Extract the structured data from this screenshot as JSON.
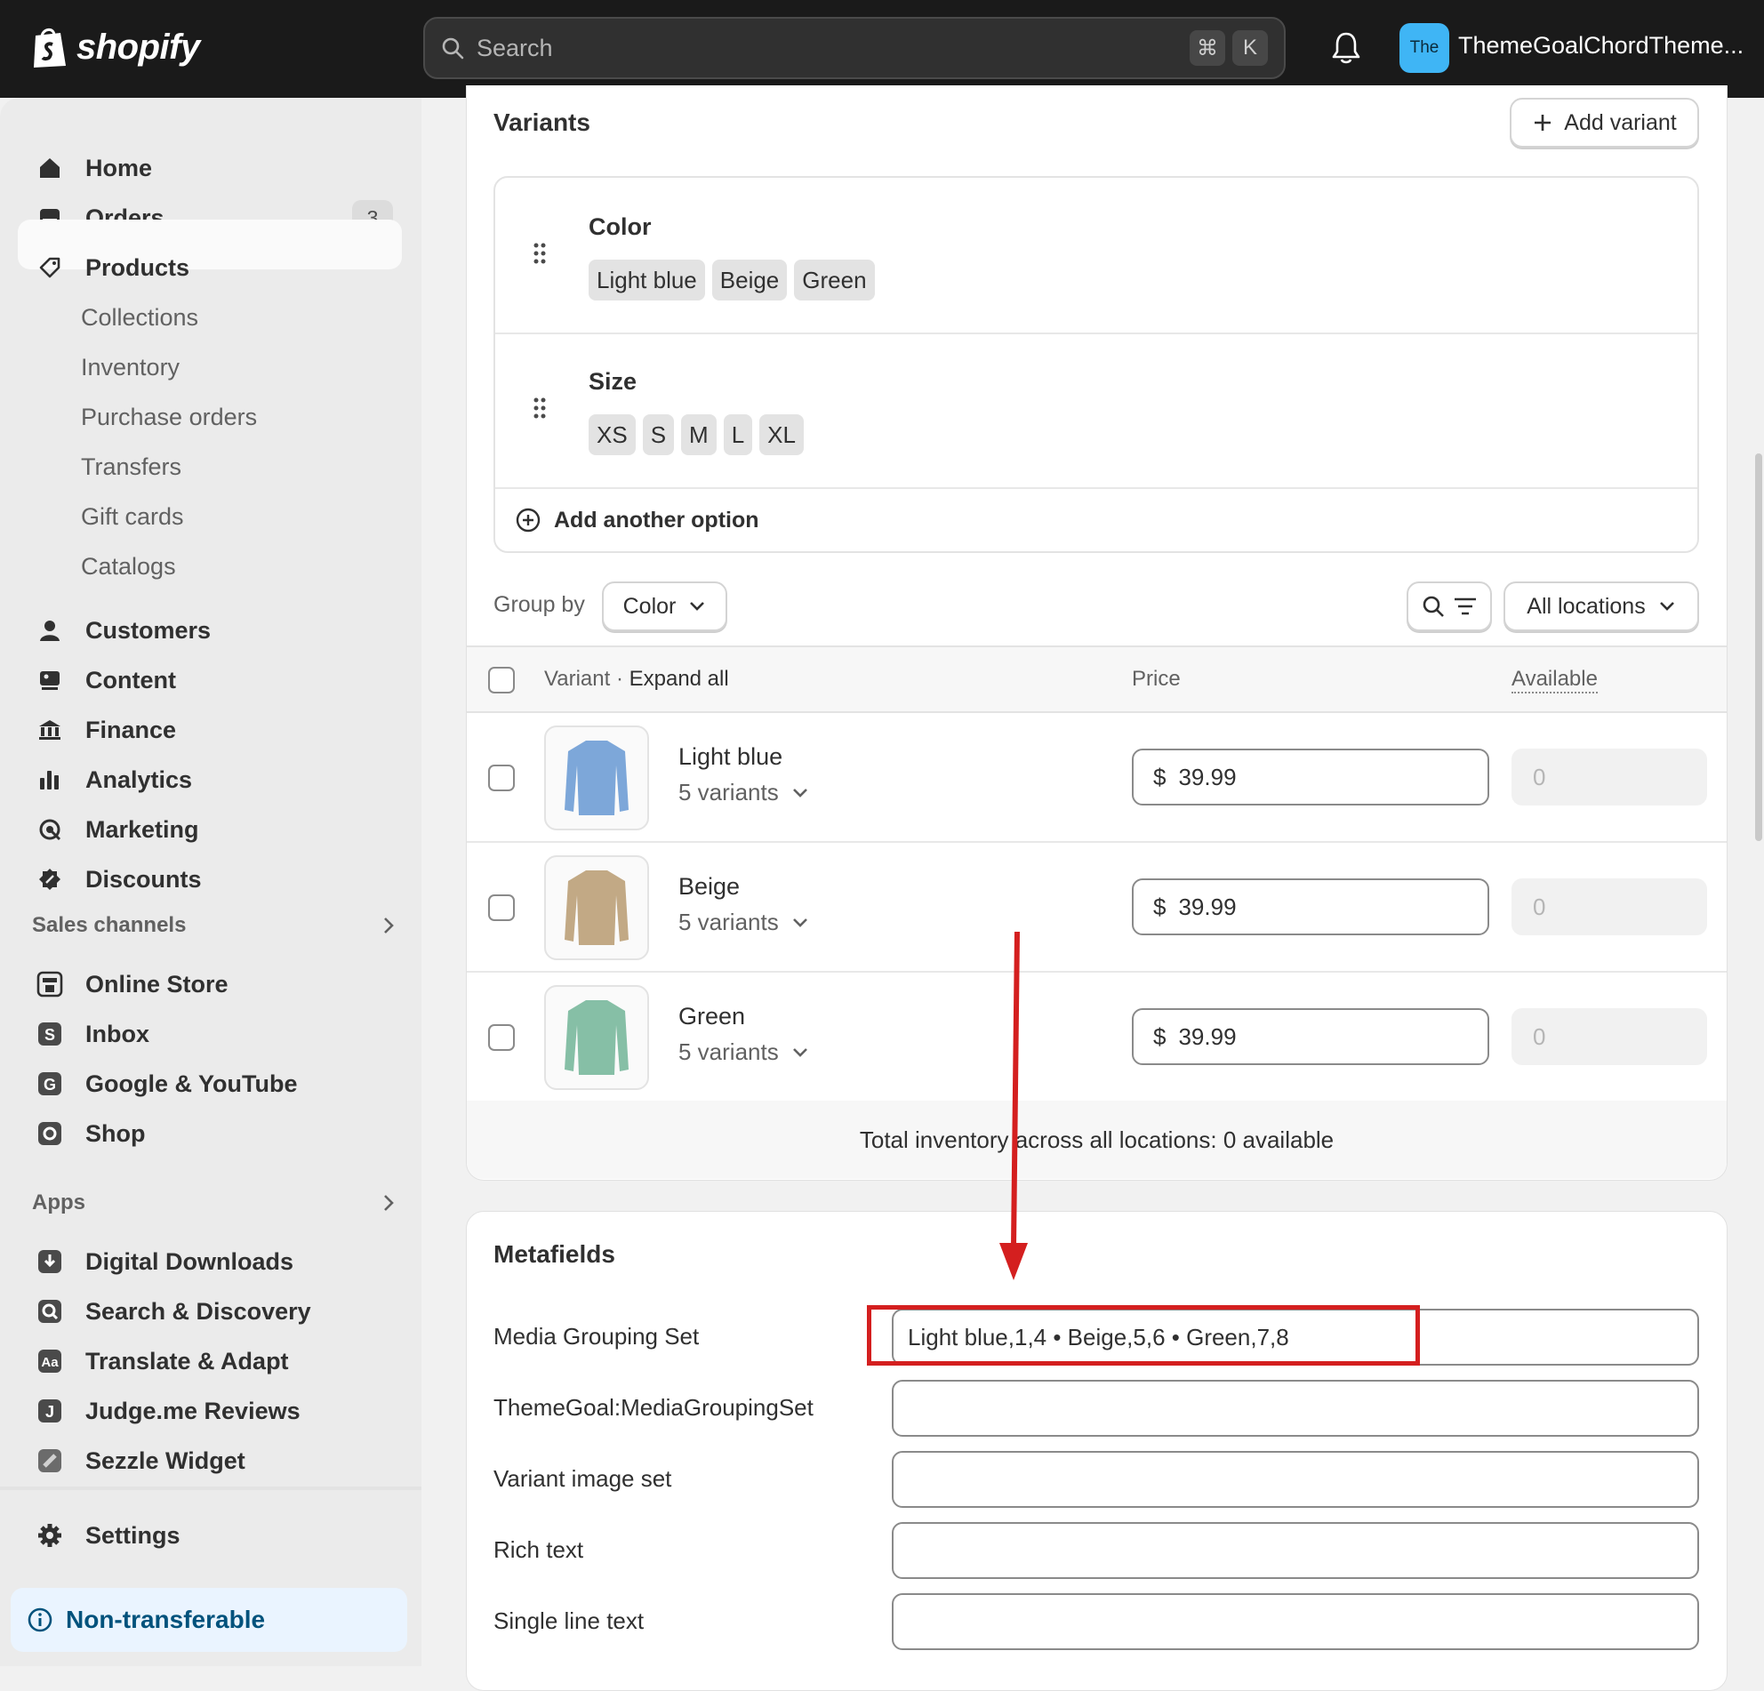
{
  "topbar": {
    "brand": "shopify",
    "search_placeholder": "Search",
    "shortcut_keys": [
      "⌘",
      "K"
    ],
    "avatar_initials": "The",
    "store_name": "ThemeGoalChordTheme..."
  },
  "sidebar": {
    "items": [
      {
        "label": "Home",
        "icon": "home-icon"
      },
      {
        "label": "Orders",
        "icon": "orders-icon",
        "badge": "3"
      },
      {
        "label": "Products",
        "icon": "tag-icon",
        "active": true
      },
      {
        "label": "Collections"
      },
      {
        "label": "Inventory"
      },
      {
        "label": "Purchase orders"
      },
      {
        "label": "Transfers"
      },
      {
        "label": "Gift cards"
      },
      {
        "label": "Catalogs"
      },
      {
        "label": "Customers",
        "icon": "person-icon"
      },
      {
        "label": "Content",
        "icon": "content-icon"
      },
      {
        "label": "Finance",
        "icon": "bank-icon"
      },
      {
        "label": "Analytics",
        "icon": "bar-chart-icon"
      },
      {
        "label": "Marketing",
        "icon": "target-icon"
      },
      {
        "label": "Discounts",
        "icon": "discount-icon"
      }
    ],
    "sales_channels": {
      "title": "Sales channels",
      "items": [
        "Online Store",
        "Inbox",
        "Google & YouTube",
        "Shop"
      ]
    },
    "apps": {
      "title": "Apps",
      "items": [
        "Digital Downloads",
        "Search & Discovery",
        "Translate & Adapt",
        "Judge.me Reviews",
        "Sezzle Widget"
      ]
    },
    "settings": "Settings",
    "non_transferable": "Non-transferable"
  },
  "variants_card": {
    "title": "Variants",
    "add_variant": "Add variant",
    "options": [
      {
        "name": "Color",
        "values": [
          "Light blue",
          "Beige",
          "Green"
        ]
      },
      {
        "name": "Size",
        "values": [
          "XS",
          "S",
          "M",
          "L",
          "XL"
        ]
      }
    ],
    "add_option": "Add another option",
    "group_by_label": "Group by",
    "group_by_value": "Color",
    "locations": "All locations",
    "table": {
      "col_variant": "Variant",
      "expand_all": "Expand all",
      "col_price": "Price",
      "col_available": "Available",
      "rows": [
        {
          "name": "Light blue",
          "count": "5 variants",
          "currency": "$",
          "price": "39.99",
          "available": "0",
          "color": "#7da7d9"
        },
        {
          "name": "Beige",
          "count": "5 variants",
          "currency": "$",
          "price": "39.99",
          "available": "0",
          "color": "#c2a985"
        },
        {
          "name": "Green",
          "count": "5 variants",
          "currency": "$",
          "price": "39.99",
          "available": "0",
          "color": "#86bfa6"
        }
      ],
      "total": "Total inventory across all locations: 0 available"
    }
  },
  "metafields_card": {
    "title": "Metafields",
    "fields": [
      {
        "label": "Media Grouping Set",
        "value": "Light blue,1,4 • Beige,5,6 • Green,7,8"
      },
      {
        "label": "ThemeGoal:MediaGroupingSet",
        "value": ""
      },
      {
        "label": "Variant image set",
        "value": ""
      },
      {
        "label": "Rich text",
        "value": ""
      },
      {
        "label": "Single line text",
        "value": ""
      }
    ]
  },
  "annotation_color": "#d41f1f"
}
